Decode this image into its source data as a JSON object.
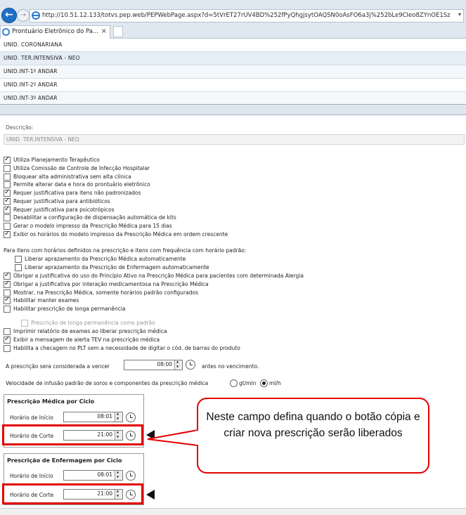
{
  "browser": {
    "url": "http://10.51.12.133/totvs.pep.web/PEPWebPage.aspx?d=5tVrET27rUV4BD%252fPyQhgjsytOAQSN0oAsFO6a3j%252bLe9CIeo8ZYnOE1Sz",
    "tab_title": "Prontuário Eletrônico do Pa...",
    "tab_close": "×"
  },
  "unit_list": [
    {
      "label": "UNID. CORONARIANA",
      "selected": false
    },
    {
      "label": "UNID. TER.INTENSIVA - NEO",
      "selected": true
    },
    {
      "label": "UNID.INT-1º ANDAR",
      "selected": false
    },
    {
      "label": "UNID.INT-2º ANDAR",
      "selected": false
    },
    {
      "label": "UNID.INT-3º ANDAR",
      "selected": false
    }
  ],
  "description": {
    "label": "Descrição:",
    "value": "UNID. TER.INTENSIVA - NEO"
  },
  "options": [
    {
      "label": "Utiliza Planejamento Terapêutico",
      "checked": true
    },
    {
      "label": "Utiliza Comissão de Controle de Infecção Hospitalar",
      "checked": false
    },
    {
      "label": "Bloquear alta administrativa sem alta clínica",
      "checked": false
    },
    {
      "label": "Permite alterar data e hora do prontuário eletrônico",
      "checked": false
    },
    {
      "label": "Requer justificativa para itens não padronizados",
      "checked": true
    },
    {
      "label": "Requer justificativa para antibióticos",
      "checked": true
    },
    {
      "label": "Requer justificativa para psicotrópicos",
      "checked": true
    },
    {
      "label": "Desabilitar a configuração de dispensação automática de kits",
      "checked": false
    },
    {
      "label": "Gerar o modelo impresso da Prescrição Médica para 15 dias",
      "checked": false
    },
    {
      "label": "Exibir os horários do modelo impresso da Prescrição Médica em ordem crescente",
      "checked": true
    }
  ],
  "aprazamento_heading": "Para itens com horários definidos na prescrição e itens com frequência com horário padrão:",
  "aprazamento": [
    {
      "label": "Liberar aprazamento da Prescrição Médica automaticamente",
      "checked": false
    },
    {
      "label": "Liberar aprazamento da Prescrição de Enfermagem automaticamente",
      "checked": false
    }
  ],
  "options2": [
    {
      "label": "Obrigar a justificativa do uso do Princípio Ativo na Prescrição Médica para pacientes com determinada Alergia",
      "checked": true
    },
    {
      "label": "Obrigar a justificativa por interação medicamentosa na Prescrição Médica",
      "checked": true
    },
    {
      "label": "Mostrar, na Prescrição Médica, somente horários padrão configurados",
      "checked": false
    },
    {
      "label": "Habilitar manter exames",
      "checked": true
    },
    {
      "label": "Habilitar prescrição de longa permanência",
      "checked": false
    }
  ],
  "longa_sub": {
    "label": "Prescrição de longa permanência como padrão",
    "checked": false,
    "disabled": true
  },
  "options3": [
    {
      "label": "Imprimir relatório de exames ao liberar prescrição médica",
      "checked": false
    },
    {
      "label": "Exibir a mensagem de alerta TEV na prescrição médica",
      "checked": true
    },
    {
      "label": "Habilita a checagem no PLT sem a necessidade de digitar o cód. de barras do produto",
      "checked": false
    }
  ],
  "vencer": {
    "prefix": "A prescrição sera considerada a vencer",
    "value": "08:00",
    "suffix": "antes no vencimento."
  },
  "velocidade": {
    "label": "Velocidade de infusão padrão de soros e componentes da prescrição médica",
    "opt1": "gt/min",
    "opt2": "ml/h",
    "selected": "ml/h"
  },
  "grupo_medica": {
    "title": "Prescrição Médica por Ciclo",
    "inicio_label": "Horário de Início",
    "inicio": "08:01",
    "corte_label": "Horário de Corte",
    "corte": "21:00"
  },
  "grupo_enf": {
    "title": "Prescrição de Enfermagem por Ciclo",
    "inicio_label": "Horário de Início",
    "inicio": "08:01",
    "corte_label": "Horário de Corte",
    "corte": "21:00"
  },
  "callout": "Neste campo defina quando o botão cópia e criar nova prescrição serão liberados",
  "colors": {
    "highlight": "#e20000",
    "selected_row": "#e5eef7"
  }
}
